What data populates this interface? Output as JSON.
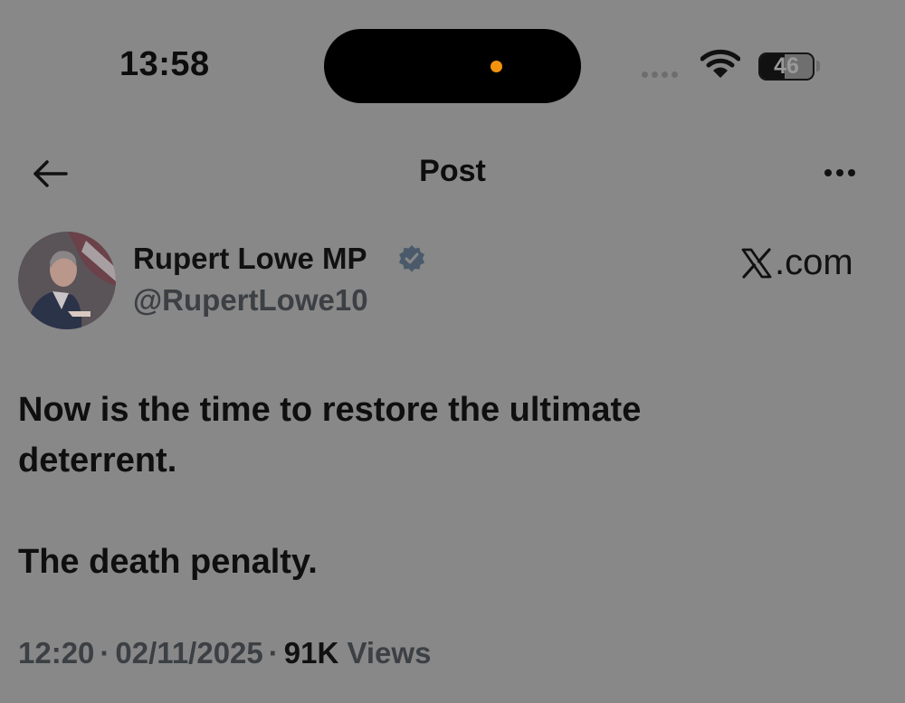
{
  "status_bar": {
    "time": "13:58",
    "battery": "46",
    "battery_level_percent": 46,
    "icons": [
      "signal-dots-icon",
      "wifi-icon",
      "battery-icon"
    ],
    "island_indicator_color": "#f2930f"
  },
  "nav": {
    "back_icon": "arrow-left-icon",
    "title": "Post",
    "more_icon": "ellipsis-icon"
  },
  "post": {
    "author": {
      "name": "Rupert Lowe MP",
      "handle": "@RupertLowe10",
      "verified_icon": "verified-badge-icon"
    },
    "source_label": ".com",
    "source_icon": "x-logo-icon",
    "text": [
      "Now is the time to restore the ultimate deterrent.",
      "The death penalty."
    ],
    "time": "12:20",
    "date": "02/11/2025",
    "views_count": "91K",
    "views_label": "Views"
  },
  "colors": {
    "background": "#888888",
    "text": "#111111",
    "secondary_text": "#3c4044"
  }
}
